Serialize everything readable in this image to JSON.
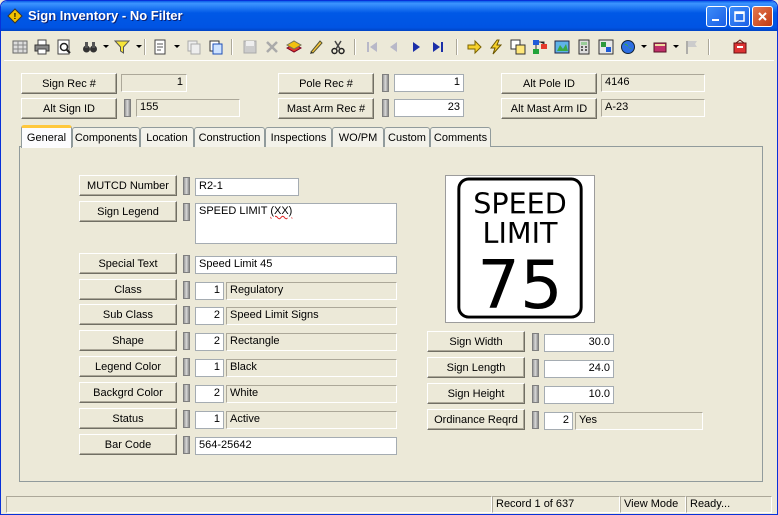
{
  "window": {
    "title": "Sign Inventory - No Filter"
  },
  "header": {
    "sign_rec_label": "Sign Rec #",
    "sign_rec_value": "1",
    "alt_sign_label": "Alt Sign ID",
    "alt_sign_value": "155",
    "pole_rec_label": "Pole Rec #",
    "pole_rec_value": "1",
    "mast_arm_label": "Mast Arm Rec #",
    "mast_arm_value": "23",
    "alt_pole_label": "Alt Pole ID",
    "alt_pole_value": "4146",
    "alt_mast_label": "Alt Mast Arm ID",
    "alt_mast_value": "A-23"
  },
  "tabs": [
    "General",
    "Components",
    "Location",
    "Construction",
    "Inspections",
    "WO/PM",
    "Custom",
    "Comments"
  ],
  "general": {
    "mutcd_label": "MUTCD Number",
    "mutcd_value": "R2-1",
    "legend_label": "Sign Legend",
    "legend_value_prefix": "SPEED LIMIT ",
    "legend_value_word": "(XX)",
    "special_label": "Special Text",
    "special_value": "Speed Limit 45",
    "class_label": "Class",
    "class_code": "1",
    "class_value": "Regulatory",
    "subclass_label": "Sub Class",
    "subclass_code": "2",
    "subclass_value": "Speed Limit Signs",
    "shape_label": "Shape",
    "shape_code": "2",
    "shape_value": "Rectangle",
    "legend_color_label": "Legend Color",
    "legend_color_code": "1",
    "legend_color_value": "Black",
    "backgrd_label": "Backgrd Color",
    "backgrd_code": "2",
    "backgrd_value": "White",
    "status_label": "Status",
    "status_code": "1",
    "status_value": "Active",
    "barcode_label": "Bar Code",
    "barcode_value": "564-25642",
    "width_label": "Sign Width",
    "width_value": "30.0",
    "length_label": "Sign Length",
    "length_value": "24.0",
    "height_label": "Sign Height",
    "height_value": "10.0",
    "ordinance_label": "Ordinance Reqrd",
    "ordinance_code": "2",
    "ordinance_value": "Yes"
  },
  "sign_image": {
    "line1": "SPEED",
    "line2": "LIMIT",
    "number": "75"
  },
  "statusbar": {
    "record": "Record 1 of 637",
    "mode": "View Mode",
    "state": "Ready..."
  },
  "colors": {
    "titlebar": "#0054E3",
    "active_tab_accent": "#FFC83C",
    "panel_bg": "#ECE9D8"
  }
}
